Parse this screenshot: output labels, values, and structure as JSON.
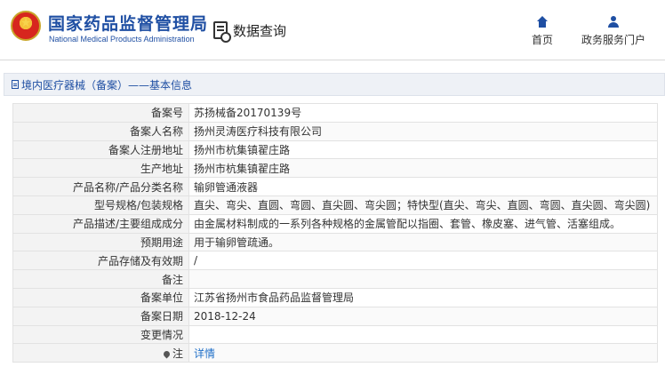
{
  "header": {
    "logo_cn": "国家药品监督管理局",
    "logo_en": "National Medical Products Administration",
    "query_label": "数据查询",
    "nav": [
      {
        "label": "首页",
        "icon": "home-icon"
      },
      {
        "label": "政务服务门户",
        "icon": "user-icon"
      }
    ]
  },
  "breadcrumb": "境内医疗器械（备案）——基本信息",
  "rows": [
    {
      "key": "备案号",
      "value": "苏扬械备20170139号"
    },
    {
      "key": "备案人名称",
      "value": "扬州灵涛医疗科技有限公司"
    },
    {
      "key": "备案人注册地址",
      "value": "扬州市杭集镇翟庄路"
    },
    {
      "key": "生产地址",
      "value": "扬州市杭集镇翟庄路"
    },
    {
      "key": "产品名称/产品分类名称",
      "value": "输卵管通液器"
    },
    {
      "key": "型号规格/包装规格",
      "value": "直尖、弯尖、直圆、弯圆、直尖圆、弯尖圆；特快型(直尖、弯尖、直圆、弯圆、直尖圆、弯尖圆)"
    },
    {
      "key": "产品描述/主要组成成分",
      "value": "由金属材料制成的一系列各种规格的金属管配以指圈、套管、橡皮塞、进气管、活塞组成。"
    },
    {
      "key": "预期用途",
      "value": "用于输卵管疏通。"
    },
    {
      "key": "产品存储及有效期",
      "value": "/"
    },
    {
      "key": "备注",
      "value": ""
    },
    {
      "key": "备案单位",
      "value": "江苏省扬州市食品药品监督管理局"
    },
    {
      "key": "备案日期",
      "value": "2018-12-24"
    },
    {
      "key": "变更情况",
      "value": ""
    }
  ],
  "note_row": {
    "key": "注",
    "value": "详情"
  },
  "colors": {
    "brand": "#1f4fa3",
    "link": "#1f6fc8"
  }
}
